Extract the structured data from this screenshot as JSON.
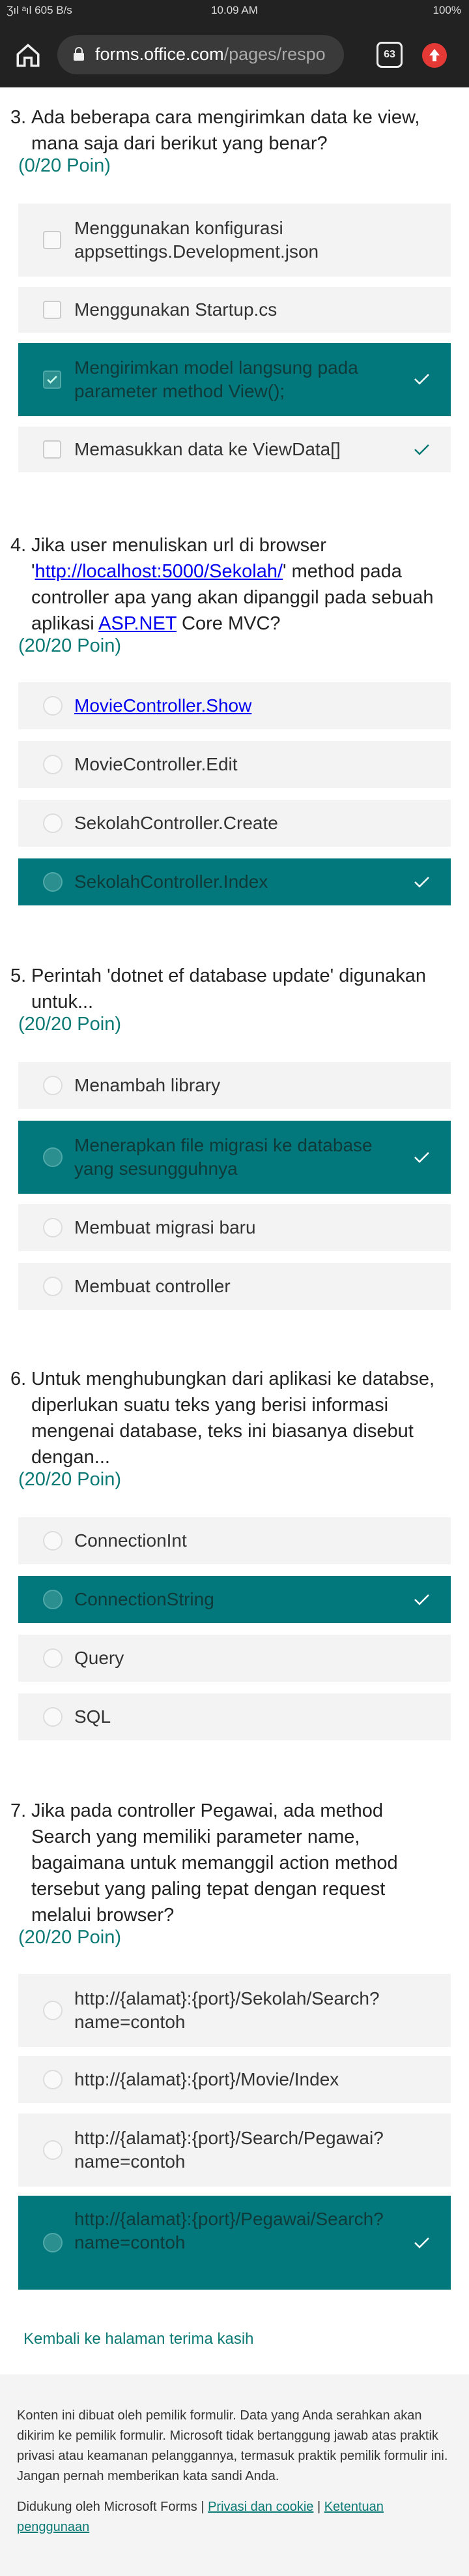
{
  "statusbar": {
    "left": "Ʒıl ᵃıl 605 B/s",
    "time": "10.09 AM",
    "battery": "100%"
  },
  "browser": {
    "url_host": "forms.office.com",
    "url_path": "/pages/respo",
    "tab_count": "63"
  },
  "questions": [
    {
      "number": "3.",
      "text": "Ada beberapa cara mengirimkan data ke view, mana saja dari berikut yang benar?",
      "score": "(0/20 Poin)",
      "options": [
        {
          "label": "Menggunakan konfigurasi appsettings.Development.json",
          "selected": false,
          "correct": false
        },
        {
          "label": "Menggunakan Startup.cs",
          "selected": false,
          "correct": false
        },
        {
          "label": "Mengirimkan model langsung pada parameter method View();",
          "selected": true,
          "correct": true
        },
        {
          "label": "Memasukkan data ke ViewData[]",
          "selected": false,
          "correct": true
        }
      ]
    },
    {
      "number": "4.",
      "text_before": "Jika user menuliskan url di browser '",
      "link1": "http://localhost:5000/Sekolah/",
      "text_mid": "' method pada controller apa yang akan dipanggil pada sebuah aplikasi ",
      "link2": "ASP.NET",
      "text_after": " Core MVC?",
      "score": "(20/20 Poin)",
      "options": [
        {
          "label": "MovieController.Show",
          "selected": false,
          "correct": false
        },
        {
          "label": "MovieController.Edit",
          "selected": false,
          "correct": false
        },
        {
          "label": "SekolahController.Create",
          "selected": false,
          "correct": false
        },
        {
          "label": "SekolahController.Index",
          "selected": true,
          "correct": true
        }
      ]
    },
    {
      "number": "5.",
      "text": "Perintah 'dotnet ef database update' digunakan untuk...",
      "score": "(20/20 Poin)",
      "options": [
        {
          "label": "Menambah library",
          "selected": false,
          "correct": false
        },
        {
          "label": "Menerapkan file migrasi ke database yang sesungguhnya",
          "selected": true,
          "correct": true
        },
        {
          "label": "Membuat migrasi baru",
          "selected": false,
          "correct": false
        },
        {
          "label": "Membuat controller",
          "selected": false,
          "correct": false
        }
      ]
    },
    {
      "number": "6.",
      "text": "Untuk menghubungkan dari aplikasi ke databse, diperlukan suatu teks yang berisi informasi mengenai database, teks ini biasanya disebut dengan...",
      "score": "(20/20 Poin)",
      "options": [
        {
          "label": "ConnectionInt",
          "selected": false,
          "correct": false
        },
        {
          "label": "ConnectionString",
          "selected": true,
          "correct": true
        },
        {
          "label": "Query",
          "selected": false,
          "correct": false
        },
        {
          "label": "SQL",
          "selected": false,
          "correct": false
        }
      ]
    },
    {
      "number": "7.",
      "text": "Jika pada controller Pegawai, ada method Search yang memiliki parameter name, bagaimana untuk memanggil action method tersebut yang paling tepat dengan request melalui browser?",
      "score": "(20/20 Poin)",
      "options": [
        {
          "label": "http://{alamat}:{port}/Sekolah/Search?name=contoh",
          "selected": false,
          "correct": false
        },
        {
          "label": "http://{alamat}:{port}/Movie/Index",
          "selected": false,
          "correct": false
        },
        {
          "label": "http://{alamat}:{port}/Search/Pegawai?name=contoh",
          "selected": false,
          "correct": false
        },
        {
          "label": "http://{alamat}:{port}/Pegawai/Search?name=contoh",
          "selected": true,
          "correct": true
        }
      ]
    }
  ],
  "back_link": "Kembali ke halaman terima kasih",
  "footer": {
    "disclaimer": "Konten ini dibuat oleh pemilik formulir. Data yang Anda serahkan akan dikirim ke pemilik formulir. Microsoft tidak bertanggung jawab atas praktik privasi atau keamanan pelanggannya, termasuk praktik pemilik formulir ini. Jangan pernah memberikan kata sandi Anda.",
    "powered_by": "Didukung oleh Microsoft Forms | ",
    "privacy_link": "Privasi dan cookie",
    "separator": " | ",
    "terms_link": "Ketentuan penggunaan"
  },
  "colors": {
    "accent": "#03787c",
    "score": "#0b7a75",
    "option_bg": "#f3f3f3"
  },
  "icons": {
    "home": "home-icon",
    "lock": "lock-icon",
    "check": "check-icon"
  }
}
